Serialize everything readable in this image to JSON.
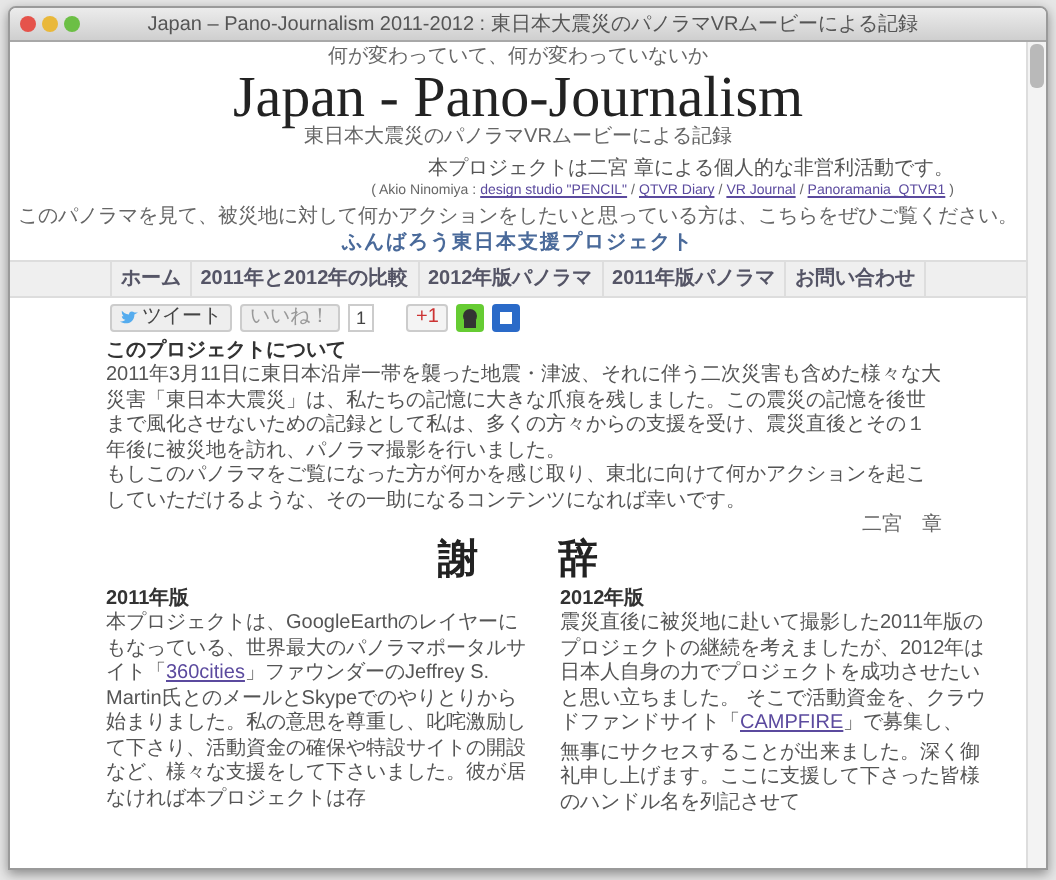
{
  "window": {
    "title": "Japan – Pano-Journalism 2011-2012 : 東日本大震災のパノラマVRムービーによる記録"
  },
  "header": {
    "tagline": "何が変わっていて、何が変わっていないか",
    "title": "Japan - Pano-Journalism",
    "subtitle": "東日本大震災のパノラマVRムービーによる記録",
    "credit": "本プロジェクトは二宮 章による個人的な非営利活動です。",
    "credit_line": [
      {
        "kind": "text",
        "text": "( Akio Ninomiya :"
      },
      {
        "kind": "link",
        "text": "design studio \"PENCIL\""
      },
      {
        "kind": "text",
        "text": "/"
      },
      {
        "kind": "link",
        "text": "QTVR Diary"
      },
      {
        "kind": "text",
        "text": "/"
      },
      {
        "kind": "link",
        "text": "VR Journal"
      },
      {
        "kind": "text",
        "text": "/"
      },
      {
        "kind": "link",
        "text": "Panoramania_QTVR1"
      },
      {
        "kind": "text",
        "text": ")"
      }
    ],
    "action_text": "このパノラマを見て、被災地に対して何かアクションをしたいと思っている方は、こちらをぜひご覧ください。",
    "action_link": "ふんばろう東日本支援プロジェクト"
  },
  "nav": [
    {
      "label": "ホーム",
      "selected": false
    },
    {
      "label": "2011年と2012年の比較",
      "selected": false
    },
    {
      "label": "2012年版パノラマ",
      "selected": false
    },
    {
      "label": "2011年版パノラマ",
      "selected": false
    },
    {
      "label": "お問い合わせ",
      "selected": false
    }
  ],
  "social": {
    "tweet": "ツイート",
    "like": "いいね！",
    "like_count": "1",
    "plus": "+1"
  },
  "about": {
    "heading": "このプロジェクトについて",
    "paragraphs": [
      "2011年3月11日に東日本沿岸一帯を襲った地震・津波、それに伴う二次災害も含めた様々な大災害「東日本大震災」は、私たちの記憶に大きな爪痕を残しました。この震災の記憶を後世まで風化させないための記録として私は、多くの方々からの支援を受け、震災直後とその１年後に被災地を訪れ、パノラマ撮影を行いました。",
      "もしこのパノラマをご覧になった方が何かを感じ取り、東北に向けて何かアクションを起こしていただけるような、その一助になるコンテンツになれば幸いです。"
    ],
    "signature": "二宮　章"
  },
  "thanks": {
    "heading": "謝　　辞",
    "columns": [
      {
        "title": "2011年版",
        "paragraphs": [
          {
            "before": "本プロジェクトは、GoogleEarthのレイヤーにもなっている、世界最大のパノラマポータルサイト「",
            "link": "360cities",
            "after": "」ファウンダーのJeffrey S. Martin氏とのメールとSkypeでのやりとりから始まりました。私の意思を尊重し、叱咤激励して下さり、活動資金の確保や特設サイトの開設など、様々な支援をして下さいました。彼が居なければ本プロジェクトは存"
          }
        ]
      },
      {
        "title": "2012年版",
        "paragraphs": [
          {
            "before": "震災直後に被災地に赴いて撮影した2011年版のプロジェクトの継続を考えましたが、2012年は日本人自身の力でプロジェクトを成功させたいと思い立ちました。 そこで活動資金を、クラウドファンドサイト「",
            "link": "CAMPFIRE",
            "after": "」で募集し、"
          },
          {
            "before": "無事にサクセスすることが出来ました。深く御礼申し上げます。ここに支援して下さった皆様のハンドル名を列記させて"
          }
        ]
      }
    ]
  }
}
